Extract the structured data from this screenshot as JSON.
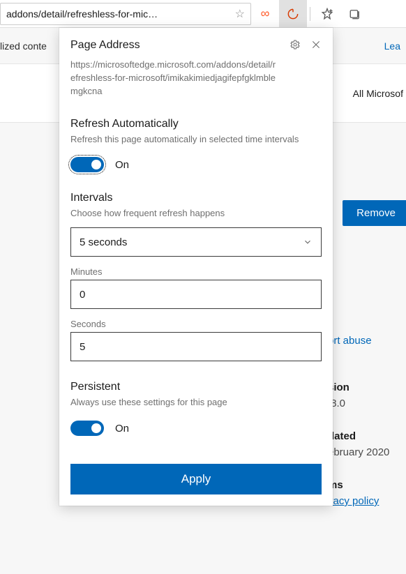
{
  "toolbar": {
    "address": "addons/detail/refreshless-for-mic…"
  },
  "background": {
    "personalized": "lized conte",
    "learn": "Lea",
    "all_microsoft": "All Microsof",
    "remove": "Remove",
    "report": "ort abuse",
    "version_label": "sion",
    "version_value": ".8.0",
    "updated_label": "dated",
    "updated_value": "ebruary 2020",
    "terms_label": "ms",
    "privacy": "vacy policy"
  },
  "popup": {
    "page_address_title": "Page Address",
    "page_address_url": "https://microsoftedge.microsoft.com/addons/detail/refreshless-for-microsoft/imikakimiedjagifepfgklmblemgkcna",
    "refresh": {
      "title": "Refresh Automatically",
      "desc": "Refresh this page automatically in selected time intervals",
      "toggle_label": "On"
    },
    "intervals": {
      "title": "Intervals",
      "desc": "Choose how frequent refresh happens",
      "select_value": "5 seconds",
      "minutes_label": "Minutes",
      "minutes_value": "0",
      "seconds_label": "Seconds",
      "seconds_value": "5"
    },
    "persistent": {
      "title": "Persistent",
      "desc": "Always use these settings for this page",
      "toggle_label": "On"
    },
    "apply": "Apply"
  }
}
